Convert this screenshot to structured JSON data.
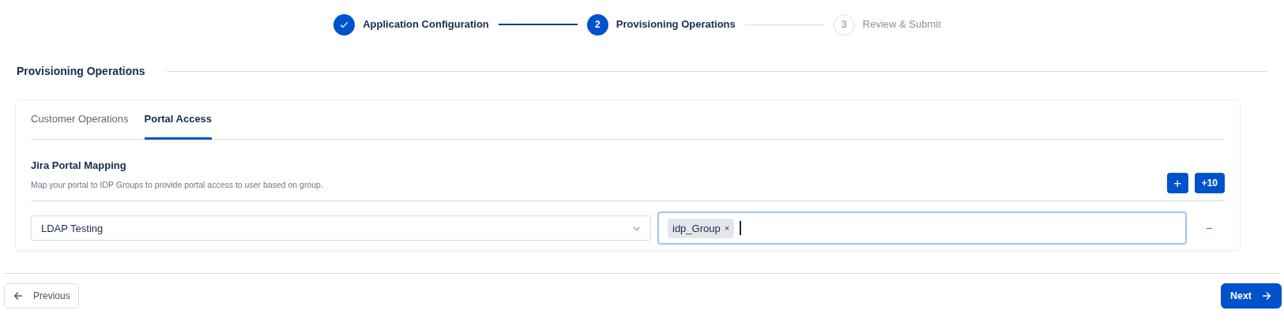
{
  "stepper": [
    {
      "label": "Application Configuration",
      "completed": true,
      "selected": false
    },
    {
      "number": "2",
      "label": "Provisioning Operations",
      "completed": false,
      "selected": true
    },
    {
      "number": "3",
      "label": "Review & Submit",
      "completed": false,
      "selected": false
    }
  ],
  "section_title": "Provisioning Operations",
  "tabs": [
    {
      "label": "Customer Operations",
      "selected": false
    },
    {
      "label": "Portal Access",
      "selected": true
    }
  ],
  "mapping": {
    "title": "Jira Portal Mapping",
    "description": "Map your portal to IDP Groups to provide portal access to user based on group.",
    "add_button": "+",
    "add_ten_button": "+10"
  },
  "rows": [
    {
      "portal": "LDAP Testing",
      "groups": [
        {
          "label": "idp_Group",
          "remove": "×"
        }
      ],
      "focused": true,
      "remove": "−"
    }
  ],
  "footer": {
    "previous": "Previous",
    "next": "Next"
  }
}
